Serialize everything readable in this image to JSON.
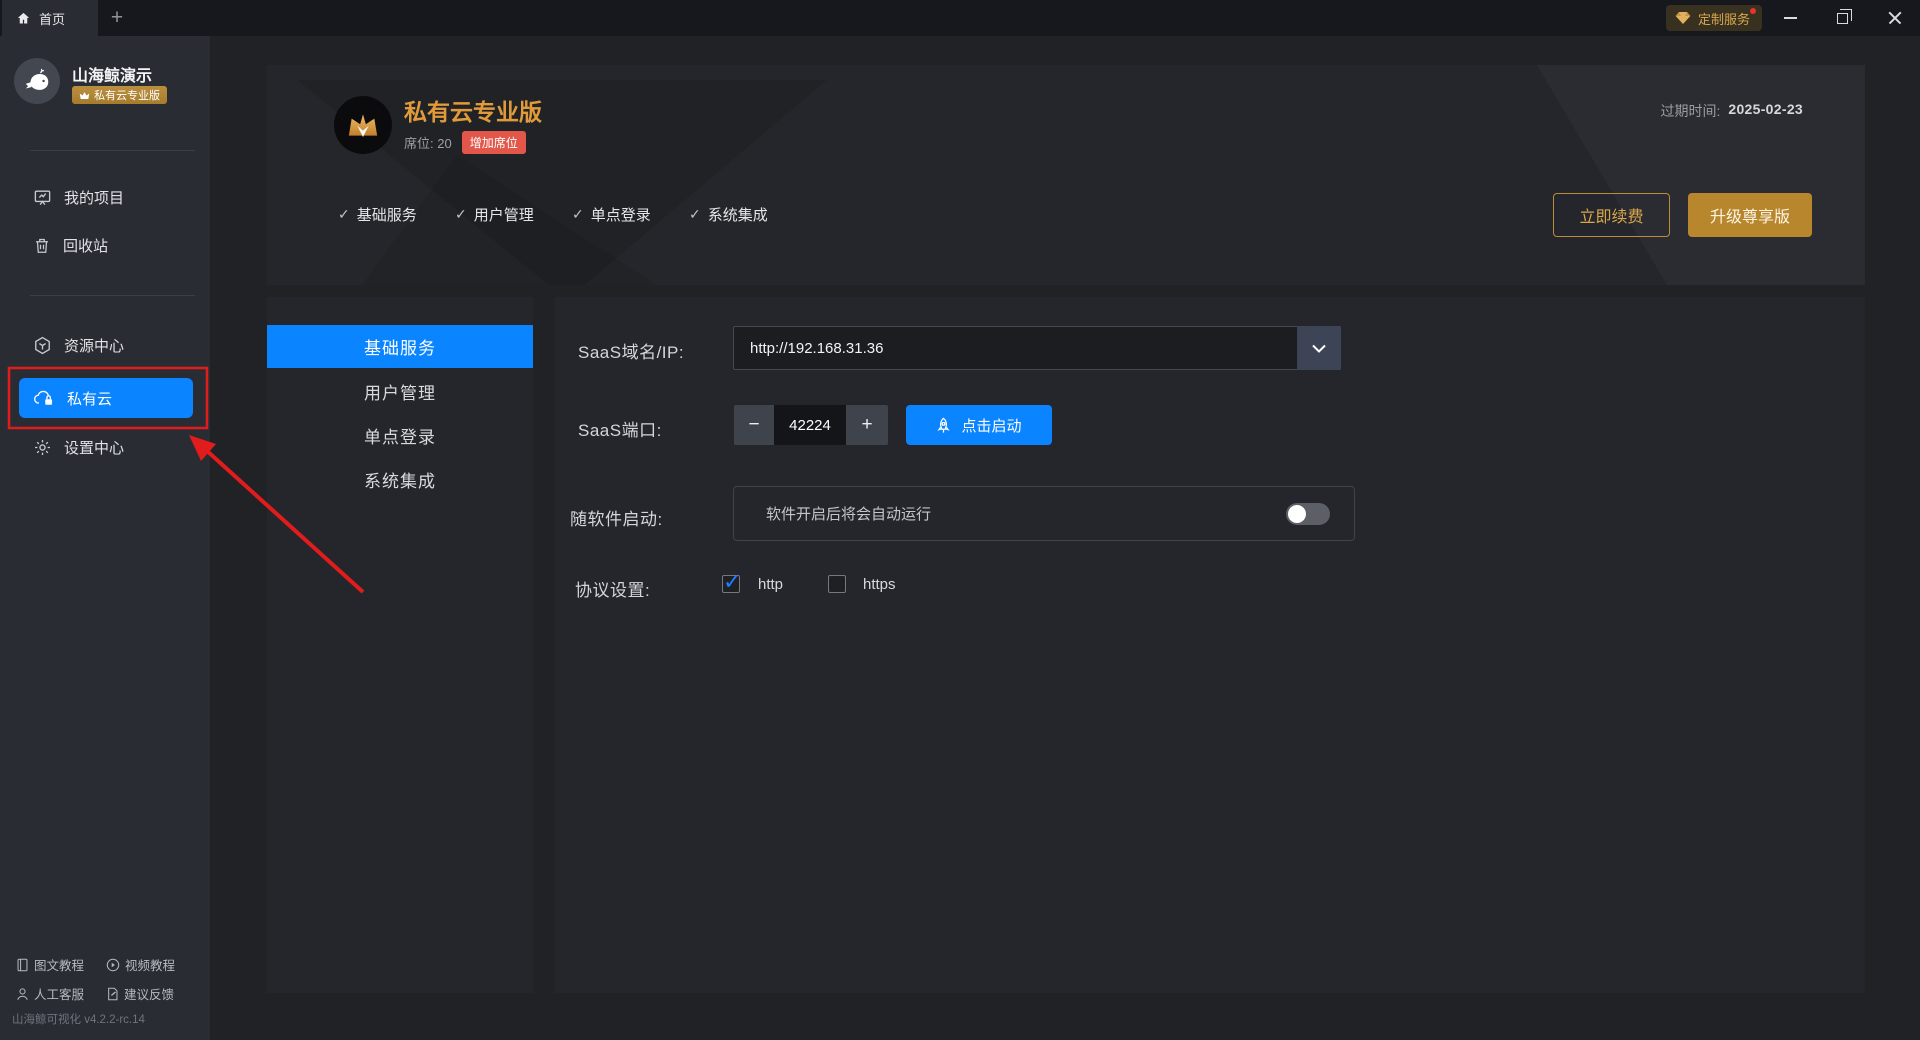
{
  "titlebar": {
    "tab_home": "首页",
    "new_tab": "+",
    "custom_service": "定制服务"
  },
  "sidebar": {
    "user": {
      "name": "山海鲸演示",
      "badge": "私有云专业版"
    },
    "items": [
      {
        "label": "我的项目"
      },
      {
        "label": "回收站"
      },
      {
        "label": "资源中心"
      },
      {
        "label": "私有云",
        "active": true
      },
      {
        "label": "设置中心"
      }
    ],
    "footer_links": [
      {
        "label": "图文教程"
      },
      {
        "label": "视频教程"
      },
      {
        "label": "人工客服"
      },
      {
        "label": "建议反馈"
      }
    ],
    "version": "山海鲸可视化 v4.2.2-rc.14"
  },
  "header": {
    "title": "私有云专业版",
    "seats": "席位: 20",
    "add_seats": "增加席位",
    "features": [
      {
        "label": "基础服务"
      },
      {
        "label": "用户管理"
      },
      {
        "label": "单点登录"
      },
      {
        "label": "系统集成"
      }
    ],
    "expire_label": "过期时间:",
    "expire_date": "2025-02-23",
    "renew_button": "立即续费",
    "upgrade_button": "升级尊享版"
  },
  "content_tabs": [
    {
      "label": "基础服务",
      "active": true
    },
    {
      "label": "用户管理"
    },
    {
      "label": "单点登录"
    },
    {
      "label": "系统集成"
    }
  ],
  "form": {
    "domain": {
      "label": "SaaS域名/IP:",
      "value": "http://192.168.31.36"
    },
    "port": {
      "label": "SaaS端口:",
      "value": "42224",
      "minus": "−",
      "plus": "+",
      "start_button": "点击启动"
    },
    "autostart": {
      "label": "随软件启动:",
      "hint": "软件开启后将会自动运行",
      "enabled": false
    },
    "protocol": {
      "label": "协议设置:",
      "options": [
        {
          "label": "http",
          "checked": true
        },
        {
          "label": "https",
          "checked": false
        }
      ]
    }
  },
  "icons": {
    "check": "✓"
  },
  "colors": {
    "accent_blue": "#0a84ff",
    "brand_gold": "#e09a3a",
    "badge_red": "#e2574a",
    "annotation_red": "#e11c1c"
  }
}
